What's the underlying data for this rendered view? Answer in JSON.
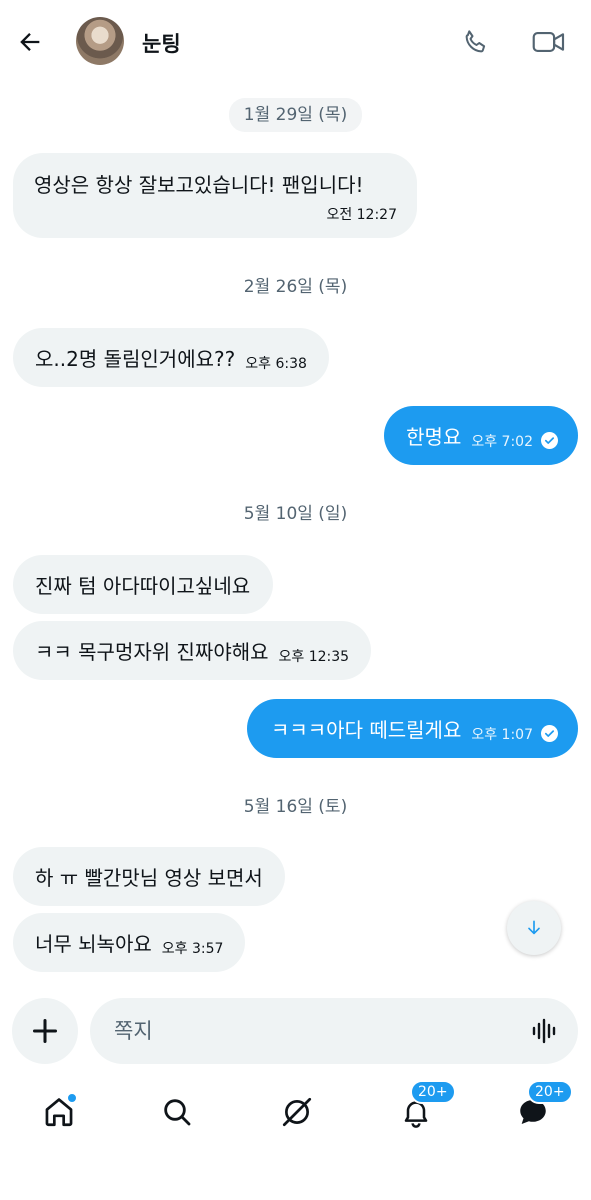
{
  "header": {
    "contact_name": "눈팅",
    "back_icon": "arrow-left-icon",
    "call_icon": "phone-icon",
    "video_icon": "video-camera-icon"
  },
  "dates": [
    "1월 29일 (목)",
    "2월 26일 (목)",
    "5월 10일 (일)",
    "5월 16일 (토)"
  ],
  "messages": [
    {
      "direction": "in",
      "text": "영상은 항상 잘보고있습니다! 팬입니다!",
      "time": "오전 12:27"
    },
    {
      "direction": "in",
      "text": "오..2명 돌림인거에요??",
      "time": "오후 6:38"
    },
    {
      "direction": "out",
      "text": "한명요",
      "time": "오후 7:02",
      "read": true
    },
    {
      "direction": "in",
      "text": "진짜 텀 아다따이고싶네요",
      "time": ""
    },
    {
      "direction": "in",
      "text": "ㅋㅋ 목구멍자위 진짜야해요",
      "time": "오후 12:35"
    },
    {
      "direction": "out",
      "text": "ㅋㅋㅋ아다 떼드릴게요",
      "time": "오후 1:07",
      "read": true
    },
    {
      "direction": "in",
      "text": "하 ㅠ 빨간맛님 영상 보면서",
      "time": ""
    },
    {
      "direction": "in",
      "text": "너무 뇌녹아요",
      "time": "오후 3:57"
    }
  ],
  "composer": {
    "placeholder": "쪽지",
    "add_icon": "plus-icon",
    "voice_icon": "voice-waveform-icon"
  },
  "scroll_button_icon": "arrow-down-icon",
  "nav": {
    "items": [
      {
        "name": "home",
        "icon": "home-icon",
        "has_dot": true
      },
      {
        "name": "search",
        "icon": "search-icon"
      },
      {
        "name": "grok",
        "icon": "grok-icon"
      },
      {
        "name": "notifications",
        "icon": "bell-icon",
        "badge": "20+"
      },
      {
        "name": "messages",
        "icon": "envelope-icon",
        "badge": "20+"
      }
    ]
  },
  "colors": {
    "accent": "#1d9bf0",
    "bubble_in": "#eff3f4",
    "text_primary": "#0f1419",
    "text_secondary": "#536471"
  }
}
